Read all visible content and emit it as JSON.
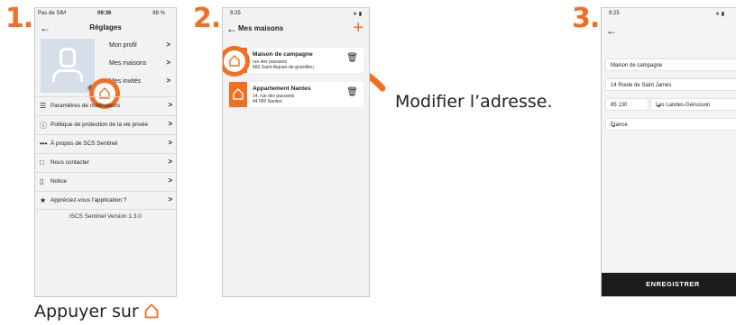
{
  "steps": {
    "one": "1.",
    "two": "2.",
    "three": "3."
  },
  "captions": {
    "step1": "Appuyer sur",
    "step2": "Modifier l’adresse."
  },
  "colors": {
    "accent": "#f26f21",
    "save_button": "#1c1c1c"
  },
  "screen1": {
    "status_left": "Pas de SIM",
    "status_time": "09:36",
    "status_right": "69 %",
    "title": "Réglages",
    "profile_items": [
      {
        "label": "Mon profil",
        "icon": "chevron-right"
      },
      {
        "label": "Mes maisons",
        "icon": "chevron-right"
      },
      {
        "label": "Mes invités",
        "icon": "chevron-right"
      }
    ],
    "settings_items": [
      {
        "label": "Paramètres de notifications",
        "icon": "sliders-icon"
      },
      {
        "label": "Politique de protection de la vie privée",
        "icon": "info-icon"
      },
      {
        "label": "À propos de SCS Sentinel",
        "icon": "more-icon"
      },
      {
        "label": "Nous contacter",
        "icon": "chat-icon"
      },
      {
        "label": "Notice",
        "icon": "document-icon"
      },
      {
        "label": "Appréciez-vous l'application ?",
        "icon": "star-icon"
      }
    ],
    "version": "iSCS Sentinel Version 1.3.0"
  },
  "screen2": {
    "status_time": "9:25",
    "title": "Mes maisons",
    "houses": [
      {
        "name": "Maison de campagne",
        "line1": "rue des passants",
        "line2": "660 Saint-Aignan-de-grandlieu"
      },
      {
        "name": "Appartement Nantes",
        "line1": "14, rue des passants",
        "line2": "44 000 Nantes"
      }
    ]
  },
  "screen3": {
    "status_time": "9:25",
    "fields": {
      "name": "Maison de campagne",
      "street": "14 Route de Saint James",
      "postal_code": "85 130",
      "city": "Les Landes-Génusson",
      "country": "France"
    },
    "save_label": "ENREGISTRER"
  }
}
